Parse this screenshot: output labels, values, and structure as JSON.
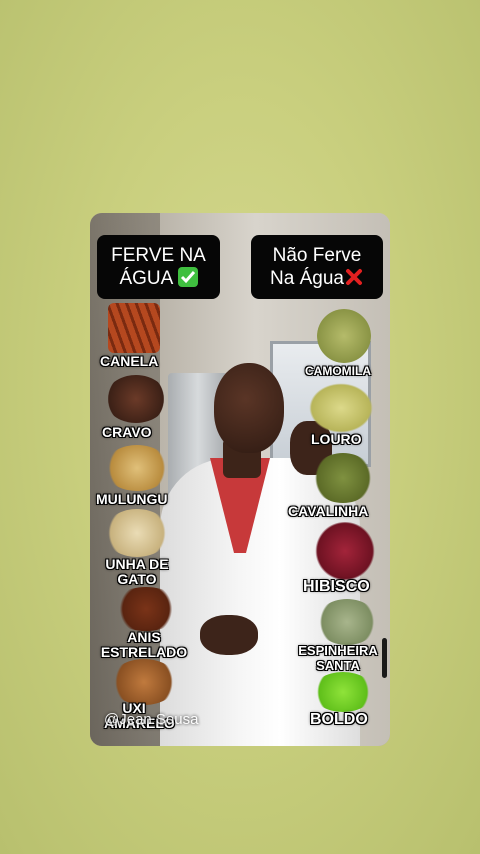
{
  "headers": {
    "left_line1": "FERVE NA",
    "left_line2": "ÁGUA",
    "left_icon": "check-mark-icon",
    "right_line1": "Não Ferve",
    "right_line2": "Na Água",
    "right_icon": "cross-mark-icon"
  },
  "left_herbs": [
    {
      "label": "CANELA",
      "color": "#b5481f"
    },
    {
      "label": "CRAVO",
      "color": "#4a2a1e"
    },
    {
      "label": "MULUNGU",
      "color": "#c9a25a"
    },
    {
      "label": "UNHA DE GATO",
      "color": "#d8c79c"
    },
    {
      "label": "ANIS ESTRELADO",
      "color": "#6b2d17"
    },
    {
      "label": "UXI AMARELO",
      "color": "#a86a35"
    }
  ],
  "right_herbs": [
    {
      "label": "CAMOMILA",
      "color": "#9da45a"
    },
    {
      "label": "LOURO",
      "color": "#c9c771"
    },
    {
      "label": "CAVALINHA",
      "color": "#6d7d34"
    },
    {
      "label": "HIBISCO",
      "color": "#8c1a2a"
    },
    {
      "label": "ESPINHEIRA SANTA",
      "color": "#8a9a6a"
    },
    {
      "label": "BOLDO",
      "color": "#7ed321"
    }
  ],
  "watermark": "@Jean Sousa",
  "colors": {
    "check": "#3fbf3f",
    "cross": "#e32020"
  }
}
